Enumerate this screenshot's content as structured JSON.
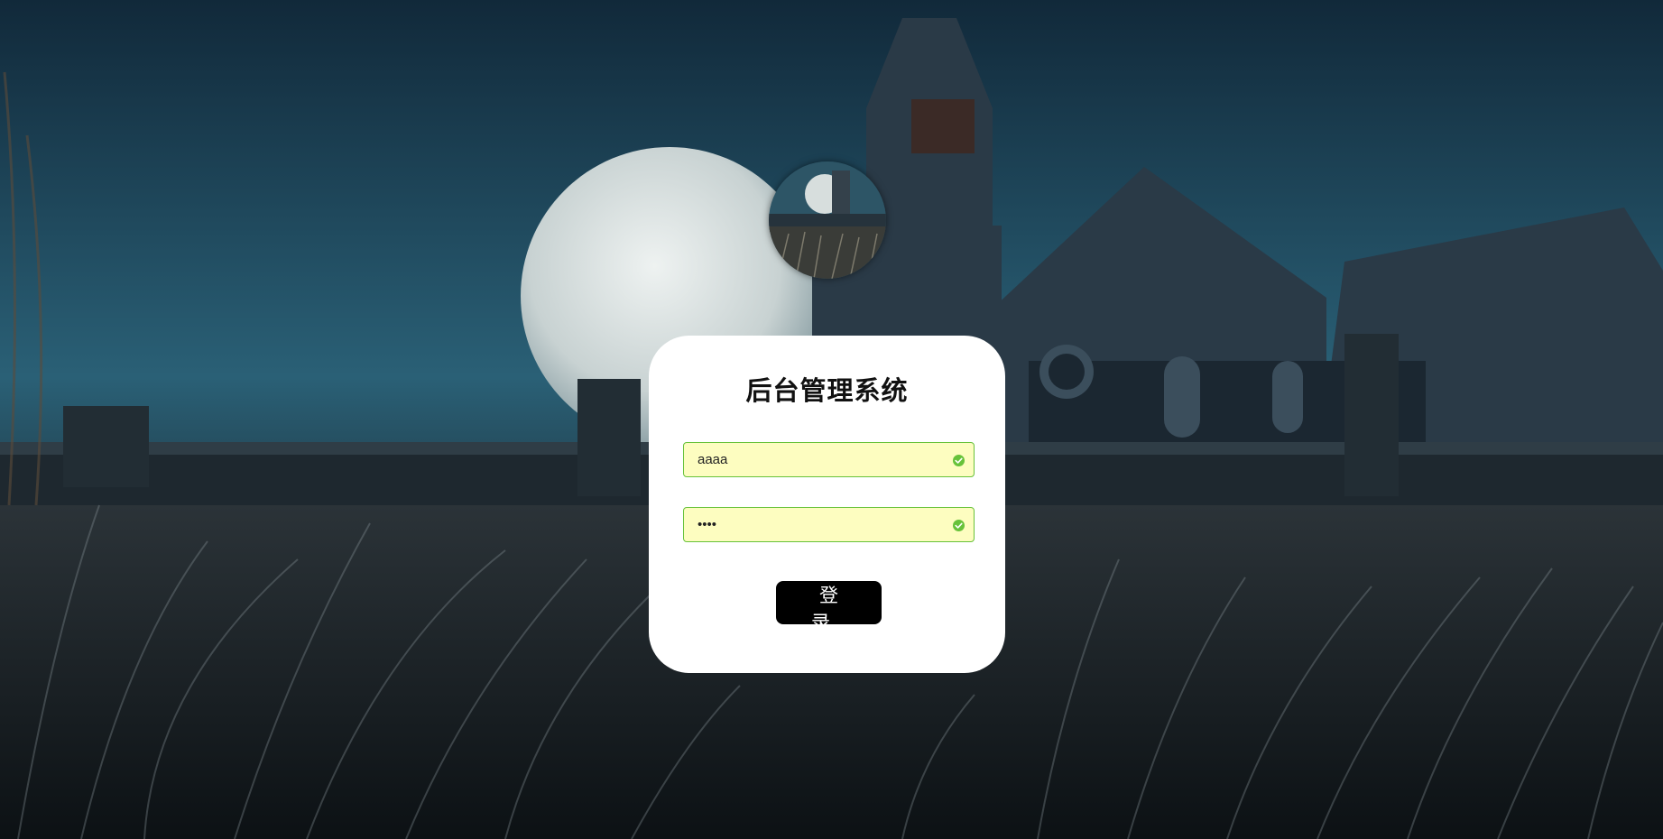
{
  "login": {
    "title": "后台管理系统",
    "username_value": "aaaa",
    "password_value": "aaaa",
    "submit_label": "登 录"
  },
  "colors": {
    "card_bg": "#ffffff",
    "field_border_valid": "#67c23a",
    "field_fill": "#fdfdc0",
    "button_bg": "#000000",
    "button_text": "#ffffff"
  },
  "icons": {
    "valid": "check-circle-icon"
  }
}
